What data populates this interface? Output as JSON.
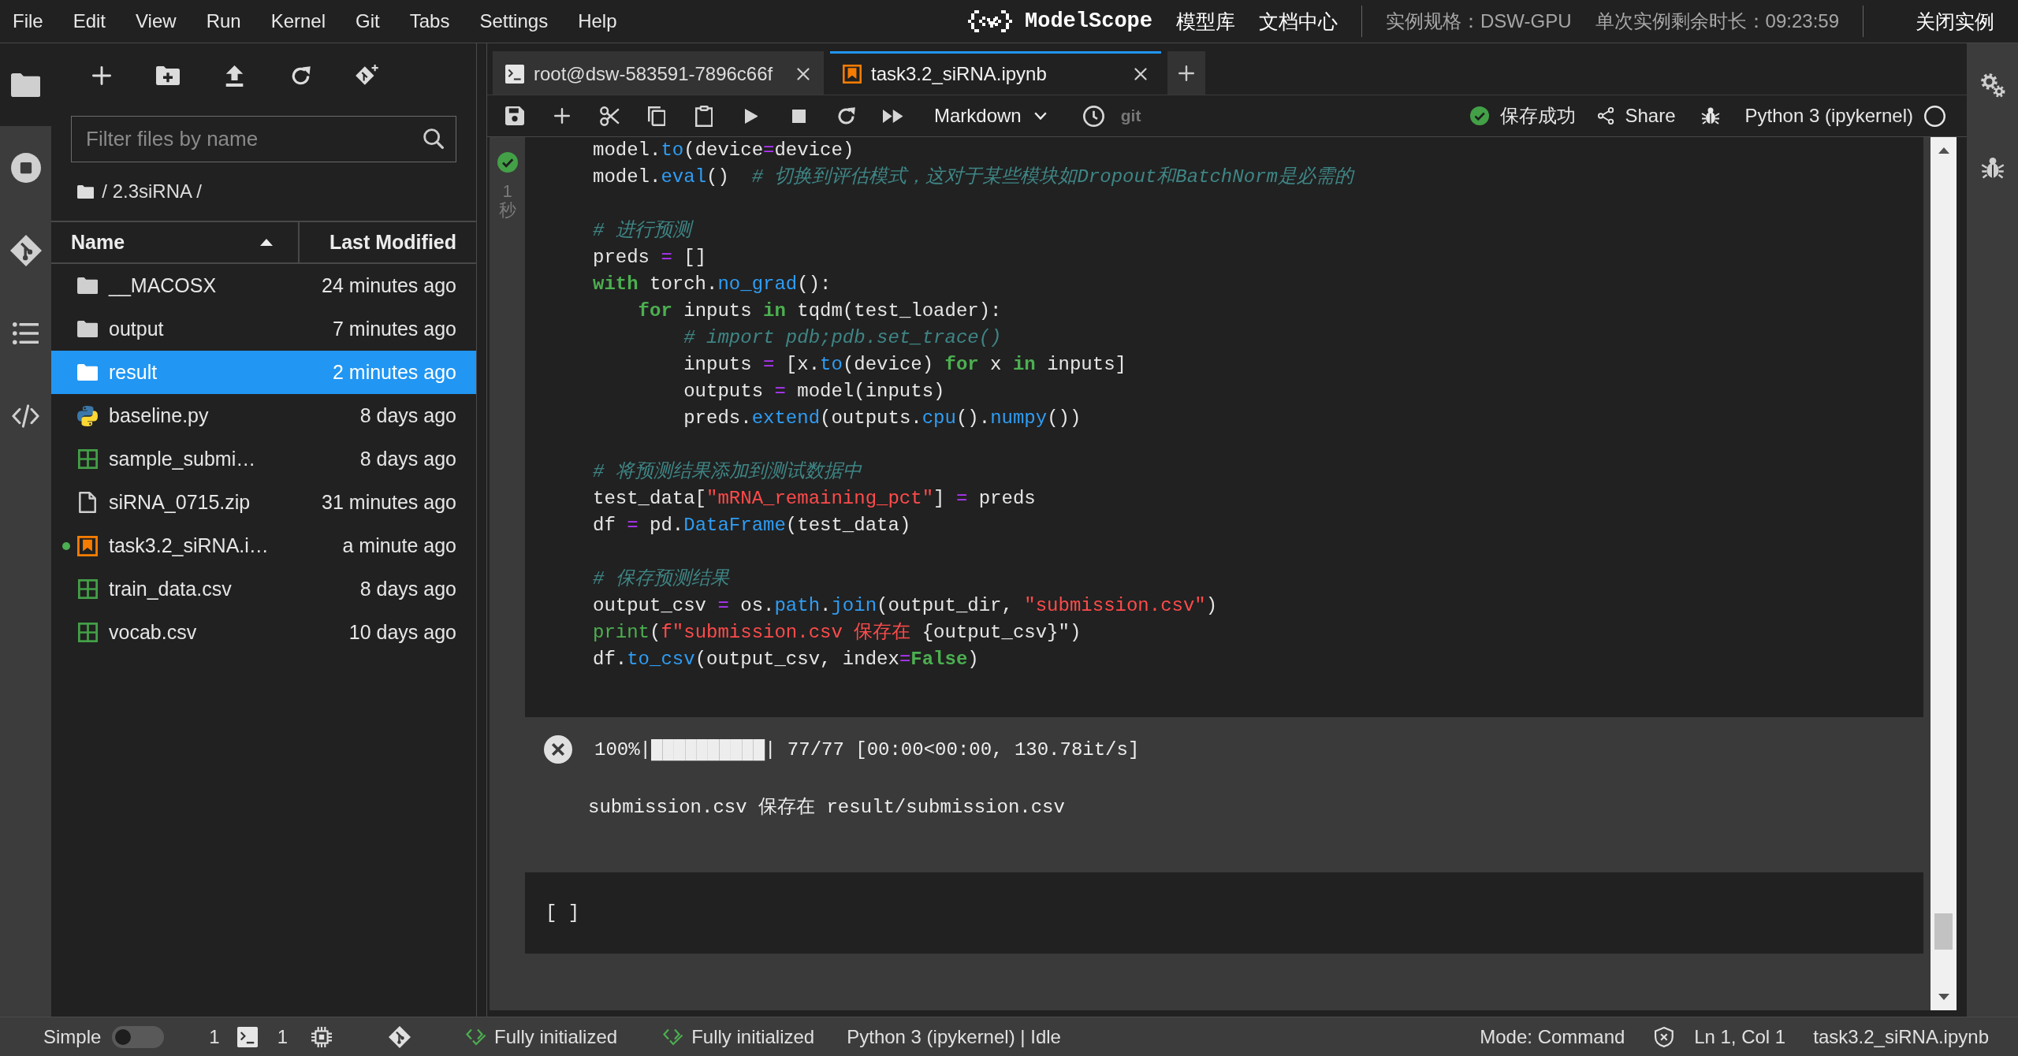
{
  "menu_bar": {
    "items": [
      "File",
      "Edit",
      "View",
      "Run",
      "Kernel",
      "Git",
      "Tabs",
      "Settings",
      "Help"
    ],
    "brand": "ModelScope",
    "links": [
      "模型库",
      "文档中心"
    ],
    "instance_spec": "实例规格：DSW-GPU",
    "remaining_time": "单次实例剩余时长：09:23:59",
    "close_instance": "关闭实例"
  },
  "activity_bar": {
    "items": [
      {
        "selected": true
      },
      {
        "selected": false
      },
      {
        "selected": false
      },
      {
        "selected": false
      },
      {
        "selected": false
      }
    ]
  },
  "file_browser": {
    "filter": {
      "placeholder": "Filter files by name"
    },
    "breadcrumb": "/ 2.3siRNA /",
    "columns": [
      {
        "label": "Name",
        "sorted": true
      },
      {
        "label": "Last Modified",
        "sorted": false
      }
    ],
    "rows": [
      {
        "name": "__MACOSX",
        "kind": "folder",
        "modified": "24 minutes ago",
        "selected": false,
        "running": false
      },
      {
        "name": "output",
        "kind": "folder",
        "modified": "7 minutes ago",
        "selected": false,
        "running": false
      },
      {
        "name": "result",
        "kind": "folder",
        "modified": "2 minutes ago",
        "selected": true,
        "running": false
      },
      {
        "name": "baseline.py",
        "kind": "python",
        "modified": "8 days ago",
        "selected": false,
        "running": false
      },
      {
        "name": "sample_submi…",
        "kind": "csv",
        "modified": "8 days ago",
        "selected": false,
        "running": false
      },
      {
        "name": "siRNA_0715.zip",
        "kind": "file",
        "modified": "31 minutes ago",
        "selected": false,
        "running": false
      },
      {
        "name": "task3.2_siRNA.i…",
        "kind": "notebook",
        "modified": "a minute ago",
        "selected": false,
        "running": true
      },
      {
        "name": "train_data.csv",
        "kind": "csv",
        "modified": "8 days ago",
        "selected": false,
        "running": false
      },
      {
        "name": "vocab.csv",
        "kind": "csv",
        "modified": "10 days ago",
        "selected": false,
        "running": false
      }
    ]
  },
  "notebook": {
    "tabs": [
      {
        "label": "root@dsw-583591-7896c66f",
        "kind": "terminal",
        "selected": false
      },
      {
        "label": "task3.2_siRNA.ipynb",
        "kind": "notebook",
        "selected": true
      }
    ],
    "toolbar": {
      "cell_type": "Markdown",
      "git": "git",
      "save_status": "保存成功",
      "share": "Share",
      "kernel": "Python 3 (ipykernel)"
    },
    "cells": [
      {
        "kind": "code",
        "succeeded": true,
        "elapsed": "1秒",
        "code_blocks": [
          [
            [
              {
                "kind": "text",
                "text": "model."
              },
              {
                "kind": "call",
                "text": "to"
              },
              {
                "kind": "text",
                "text": "(device"
              },
              {
                "kind": "op",
                "text": "="
              },
              {
                "kind": "text",
                "text": "device)"
              }
            ],
            [
              {
                "kind": "text",
                "text": "model."
              },
              {
                "kind": "call",
                "text": "eval"
              },
              {
                "kind": "text",
                "text": "()  "
              },
              {
                "kind": "comment",
                "text": "# 切换到评估模式，这对于某些模块如Dropout和BatchNorm是必需的"
              }
            ]
          ],
          [
            [
              {
                "kind": "comment",
                "text": "# 进行预测"
              }
            ],
            [
              {
                "kind": "text",
                "text": "preds "
              },
              {
                "kind": "op",
                "text": "="
              },
              {
                "kind": "text",
                "text": " []"
              }
            ],
            [
              {
                "kind": "kw",
                "text": "with"
              },
              {
                "kind": "text",
                "text": " torch."
              },
              {
                "kind": "call",
                "text": "no_grad"
              },
              {
                "kind": "text",
                "text": "():"
              }
            ],
            [
              {
                "kind": "kw",
                "text": "    for"
              },
              {
                "kind": "text",
                "text": " inputs "
              },
              {
                "kind": "kw",
                "text": "in"
              },
              {
                "kind": "text",
                "text": " tqdm(test_loader):"
              }
            ],
            [
              {
                "kind": "comment",
                "text": "        # import pdb;pdb.set_trace()"
              }
            ],
            [
              {
                "kind": "text",
                "text": "        inputs "
              },
              {
                "kind": "op",
                "text": "="
              },
              {
                "kind": "text",
                "text": " [x."
              },
              {
                "kind": "call",
                "text": "to"
              },
              {
                "kind": "text",
                "text": "(device) "
              },
              {
                "kind": "kw",
                "text": "for"
              },
              {
                "kind": "text",
                "text": " x "
              },
              {
                "kind": "kw",
                "text": "in"
              },
              {
                "kind": "text",
                "text": " inputs]"
              }
            ],
            [
              {
                "kind": "text",
                "text": "        outputs "
              },
              {
                "kind": "op",
                "text": "="
              },
              {
                "kind": "text",
                "text": " model(inputs)"
              }
            ],
            [
              {
                "kind": "text",
                "text": "        preds."
              },
              {
                "kind": "call",
                "text": "extend"
              },
              {
                "kind": "text",
                "text": "(outputs."
              },
              {
                "kind": "call",
                "text": "cpu"
              },
              {
                "kind": "text",
                "text": "()."
              },
              {
                "kind": "call",
                "text": "numpy"
              },
              {
                "kind": "text",
                "text": "())"
              }
            ]
          ],
          [
            [
              {
                "kind": "comment",
                "text": "# 将预测结果添加到测试数据中"
              }
            ],
            [
              {
                "kind": "text",
                "text": "test_data["
              },
              {
                "kind": "str",
                "text": "\"mRNA_remaining_pct\""
              },
              {
                "kind": "text",
                "text": "] "
              },
              {
                "kind": "op",
                "text": "="
              },
              {
                "kind": "text",
                "text": " preds"
              }
            ],
            [
              {
                "kind": "text",
                "text": "df "
              },
              {
                "kind": "op",
                "text": "="
              },
              {
                "kind": "text",
                "text": " pd."
              },
              {
                "kind": "call",
                "text": "DataFrame"
              },
              {
                "kind": "text",
                "text": "(test_data)"
              }
            ]
          ],
          [
            [
              {
                "kind": "comment",
                "text": "# 保存预测结果"
              }
            ],
            [
              {
                "kind": "text",
                "text": "output_csv "
              },
              {
                "kind": "op",
                "text": "="
              },
              {
                "kind": "text",
                "text": " os."
              },
              {
                "kind": "call",
                "text": "path"
              },
              {
                "kind": "text",
                "text": "."
              },
              {
                "kind": "call",
                "text": "join"
              },
              {
                "kind": "text",
                "text": "(output_dir, "
              },
              {
                "kind": "str",
                "text": "\"submission.csv\""
              },
              {
                "kind": "text",
                "text": ")"
              }
            ],
            [
              {
                "kind": "builtin",
                "text": "print"
              },
              {
                "kind": "text",
                "text": "("
              },
              {
                "kind": "str",
                "text": "f\"submission.csv 保存在 "
              },
              {
                "kind": "text",
                "text": "{output_csv}\")"
              }
            ],
            [
              {
                "kind": "text",
                "text": "df."
              },
              {
                "kind": "call",
                "text": "to_csv"
              },
              {
                "kind": "text",
                "text": "(output_csv, index"
              },
              {
                "kind": "op",
                "text": "="
              },
              {
                "kind": "kw",
                "text": "False"
              },
              {
                "kind": "text",
                "text": ")"
              }
            ]
          ]
        ],
        "outputs": [
          {
            "kind": "stderr",
            "text": "100%|██████████| 77/77 [00:00<00:00, 130.78it/s]"
          },
          {
            "kind": "stdout",
            "text": "submission.csv 保存在 result/submission.csv"
          }
        ]
      },
      {
        "kind": "code",
        "prompt": "[ ]"
      }
    ]
  },
  "status_bar": {
    "simple": {
      "label": "Simple",
      "on": false
    },
    "terminals": "1",
    "kernels": "1",
    "lsp_statuses": [
      "Fully initialized",
      "Fully initialized"
    ],
    "kernel_status": "Python 3 (ipykernel) | Idle",
    "mode": "Mode: Command",
    "cursor": "Ln 1, Col 1",
    "file": "task3.2_siRNA.ipynb"
  }
}
